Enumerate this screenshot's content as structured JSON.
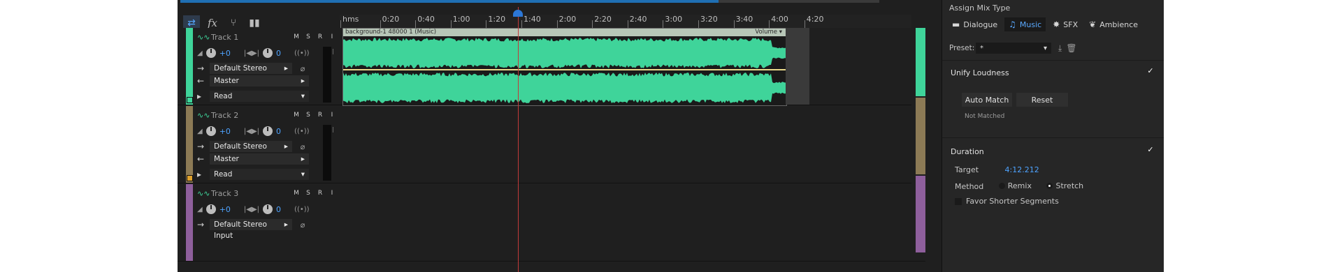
{
  "toolbar": {
    "icons": [
      "arrows-swap-icon",
      "fx-icon",
      "branch-icon",
      "bars-icon",
      "metronome-off-icon",
      "metronome-icon",
      "headphones-icon"
    ],
    "fx_label": "fx"
  },
  "ruler": {
    "ticks": [
      "hms",
      "0:20",
      "0:40",
      "1:00",
      "1:20",
      "1:40",
      "2:00",
      "2:20",
      "2:40",
      "3:00",
      "3:20",
      "3:40",
      "4:00",
      "4:20"
    ]
  },
  "colors": {
    "wave": "#3fd49a",
    "accent": "#4ea3ff",
    "track1": "#3fd49a",
    "track2": "#8c7a55",
    "track3": "#8e5f9c"
  },
  "tracks": [
    {
      "name": "Track 1",
      "m": "M",
      "s": "S",
      "r": "R",
      "i": "I",
      "volume": "+0",
      "pan": "0",
      "input": "Default Stereo Input",
      "output": "Master",
      "mode": "Read",
      "clip": {
        "name": "background-1 48000 1 (Music)",
        "volume_label": "Volume"
      }
    },
    {
      "name": "Track 2",
      "m": "M",
      "s": "S",
      "r": "R",
      "i": "I",
      "volume": "+0",
      "pan": "0",
      "input": "Default Stereo Input",
      "output": "Master",
      "mode": "Read"
    },
    {
      "name": "Track 3",
      "m": "M",
      "s": "S",
      "r": "R",
      "i": "I",
      "volume": "+0",
      "pan": "0",
      "input": "Default Stereo Input"
    }
  ],
  "panel": {
    "title": "Assign Mix Type",
    "types": [
      {
        "label": "Dialogue",
        "icon": "speech-bubble-icon"
      },
      {
        "label": "Music",
        "icon": "music-note-icon"
      },
      {
        "label": "SFX",
        "icon": "burst-icon"
      },
      {
        "label": "Ambience",
        "icon": "leaf-icon"
      }
    ],
    "preset_label": "Preset:",
    "preset_value": "*",
    "unify": {
      "title": "Unify Loudness",
      "auto_match": "Auto Match",
      "reset": "Reset",
      "status": "Not Matched"
    },
    "duration": {
      "title": "Duration",
      "target_label": "Target",
      "target_value": "4:12.212",
      "method_label": "Method",
      "remix": "Remix",
      "stretch": "Stretch",
      "favor": "Favor Shorter Segments"
    }
  }
}
